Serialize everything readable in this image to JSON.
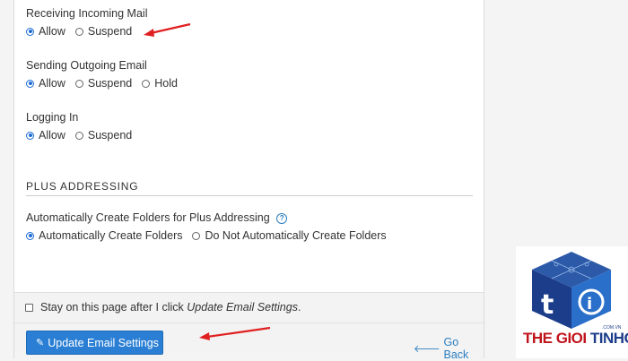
{
  "incoming": {
    "label": "Receiving Incoming Mail",
    "options": [
      "Allow",
      "Suspend"
    ],
    "selected": "Allow"
  },
  "outgoing": {
    "label": "Sending Outgoing Email",
    "options": [
      "Allow",
      "Suspend",
      "Hold"
    ],
    "selected": "Allow"
  },
  "login": {
    "label": "Logging In",
    "options": [
      "Allow",
      "Suspend"
    ],
    "selected": "Allow"
  },
  "plus": {
    "section_title": "PLUS ADDRESSING",
    "label": "Automatically Create Folders for Plus Addressing",
    "options": [
      "Automatically Create Folders",
      "Do Not Automatically Create Folders"
    ],
    "selected": "Automatically Create Folders"
  },
  "footer": {
    "stay_label_prefix": "Stay on this page after I click ",
    "stay_label_emph": "Update Email Settings",
    "stay_label_suffix": ".",
    "update_button": "Update Email Settings",
    "go_back": "Go Back"
  },
  "watermark": {
    "text_red": "THE GIOI",
    "text_blue": "TINHOC",
    "sub": ".COM.VN"
  },
  "colors": {
    "accent": "#2a7fd4",
    "link": "#2b7ec1",
    "annotation_arrow": "#e02020",
    "logo_red": "#c0141c",
    "logo_blue": "#1c3d8a"
  }
}
